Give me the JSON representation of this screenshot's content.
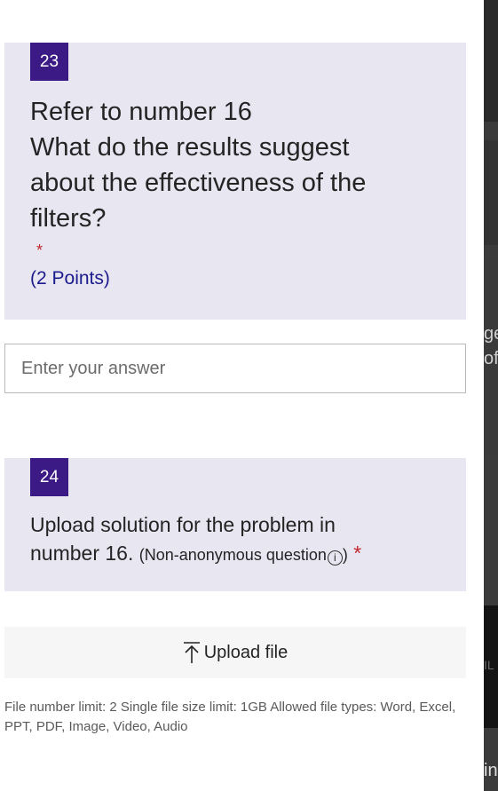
{
  "question_23": {
    "number": "23",
    "title_lines": [
      "Refer to number 16",
      "What do the results suggest",
      "about the effectiveness of the",
      "filters?"
    ],
    "required_mark": "*",
    "points": "(2 Points)",
    "answer_placeholder": "Enter your answer"
  },
  "question_24": {
    "number": "24",
    "title_line1": "Upload solution for the problem in",
    "title_line2": "number 16.",
    "note": "(Non-anonymous question",
    "info_symbol": "i",
    "note_close": ")",
    "required_mark": "*",
    "upload_label": "Upload file",
    "limits": "File number limit: 2   Single file size limit: 1GB   Allowed file types: Word, Excel, PPT, PDF, Image, Video, Audio"
  },
  "right_edge": {
    "fragment_1": "ge",
    "fragment_2": "of",
    "fragment_3": "IL",
    "fragment_4": "in"
  }
}
